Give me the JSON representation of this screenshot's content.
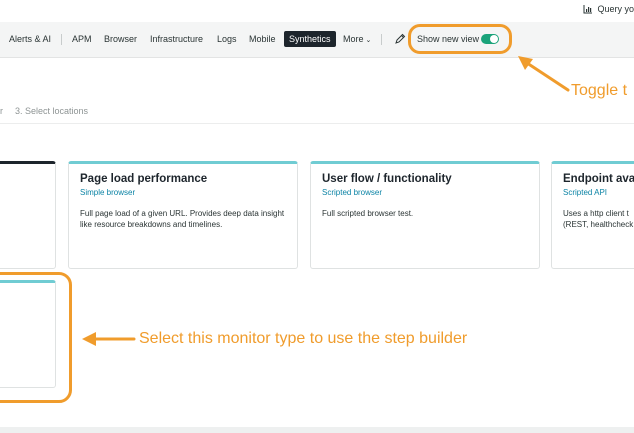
{
  "header": {
    "query_label": "Query yo",
    "query_icon": "chart-icon"
  },
  "nav": {
    "items": [
      {
        "label": "Alerts & AI"
      },
      {
        "label": "APM"
      },
      {
        "label": "Browser"
      },
      {
        "label": "Infrastructure"
      },
      {
        "label": "Logs"
      },
      {
        "label": "Mobile"
      },
      {
        "label": "Synthetics",
        "active": true
      },
      {
        "label": "More"
      }
    ],
    "more_chevron": "⌄",
    "edit_icon": "pencil-icon",
    "toggle_label": "Show new view",
    "toggle_on": true
  },
  "breadcrumb": {
    "prev_step_fragment": "r",
    "step3": "3. Select locations"
  },
  "cards": [
    {
      "title": "",
      "subtitle": "",
      "desc": "",
      "selected": true
    },
    {
      "title": "Page load performance",
      "subtitle": "Simple browser",
      "desc": "Full page load of a given URL. Provides deep data insight like resource breakdowns and timelines."
    },
    {
      "title": "User flow / functionality",
      "subtitle": "Scripted browser",
      "desc": "Full scripted browser test."
    },
    {
      "title": "Endpoint avai",
      "subtitle": "Scripted API",
      "desc": "Uses a http client t (REST, healthcheck"
    },
    {
      "title": "",
      "subtitle": "",
      "desc": ""
    }
  ],
  "annotations": {
    "toggle_note": "Toggle t",
    "step_builder_note": "Select this monitor type to use the step builder"
  },
  "colors": {
    "accent_orange": "#f09c2c",
    "toggle_green": "#1aa37a",
    "card_top_teal": "#70ccd3",
    "link_blue": "#0b83a5",
    "active_nav_bg": "#1d252c"
  }
}
